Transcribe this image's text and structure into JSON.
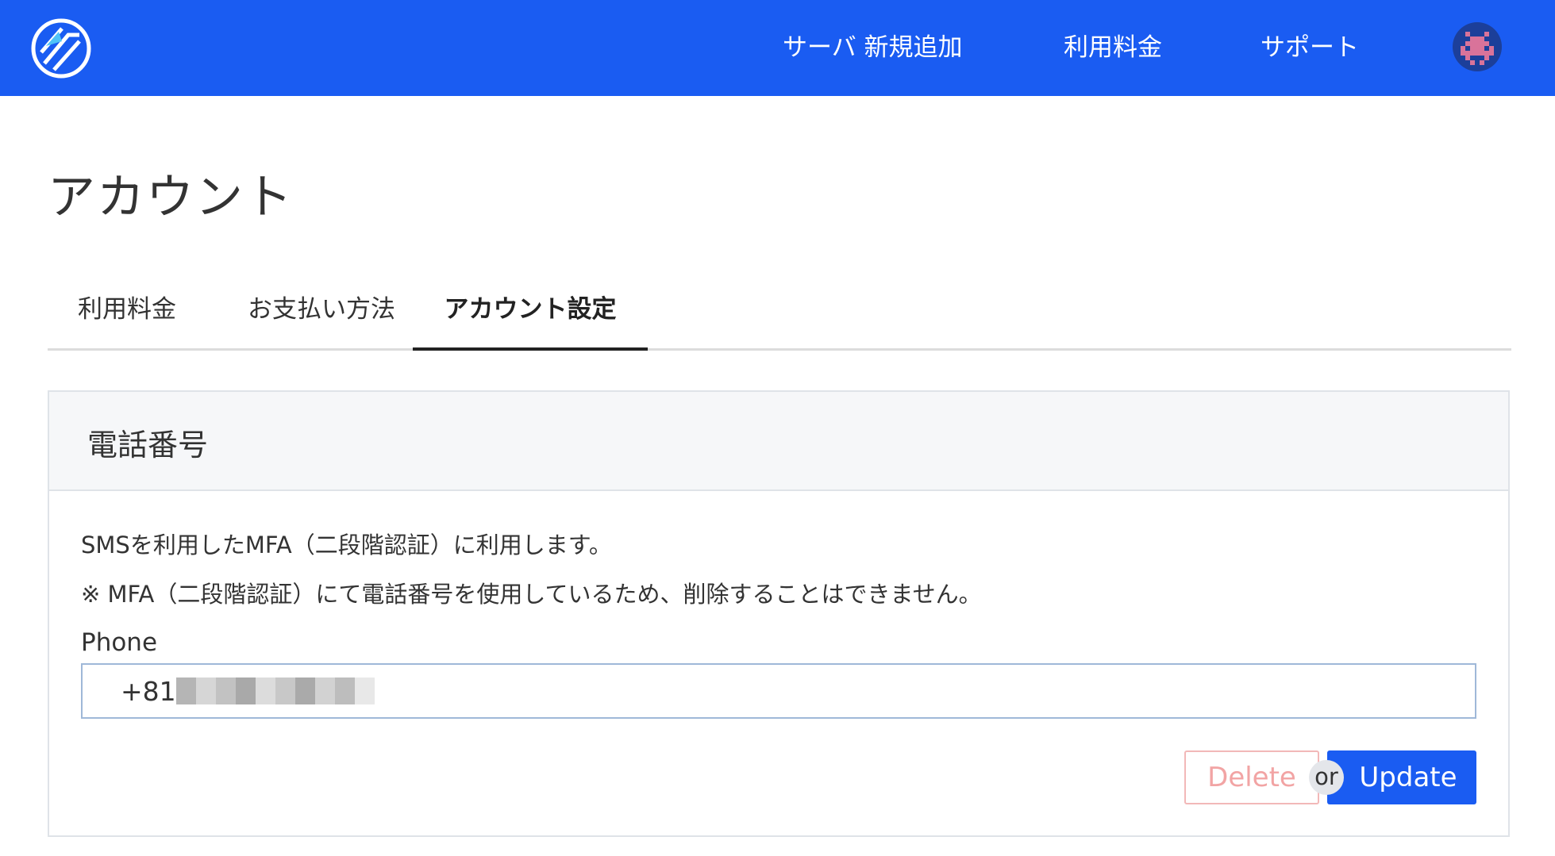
{
  "header": {
    "nav": [
      {
        "label": "サーバ 新規追加"
      },
      {
        "label": "利用料金"
      },
      {
        "label": "サポート"
      }
    ],
    "colors": {
      "brand": "#1a5cf2",
      "avatar_bg": "#1c3f9a",
      "avatar_invader": "#d9739a"
    }
  },
  "page": {
    "title": "アカウント"
  },
  "tabs": [
    {
      "label": "利用料金",
      "active": false
    },
    {
      "label": "お支払い方法",
      "active": false
    },
    {
      "label": "アカウント設定",
      "active": true
    }
  ],
  "card": {
    "title": "電話番号",
    "description_1": "SMSを利用したMFA（二段階認証）に利用します。",
    "description_2": "※ MFA（二段階認証）にて電話番号を使用しているため、削除することはできません。",
    "phone": {
      "label": "Phone",
      "country_code": "+81"
    },
    "actions": {
      "delete_label": "Delete",
      "or_label": "or",
      "update_label": "Update"
    }
  }
}
